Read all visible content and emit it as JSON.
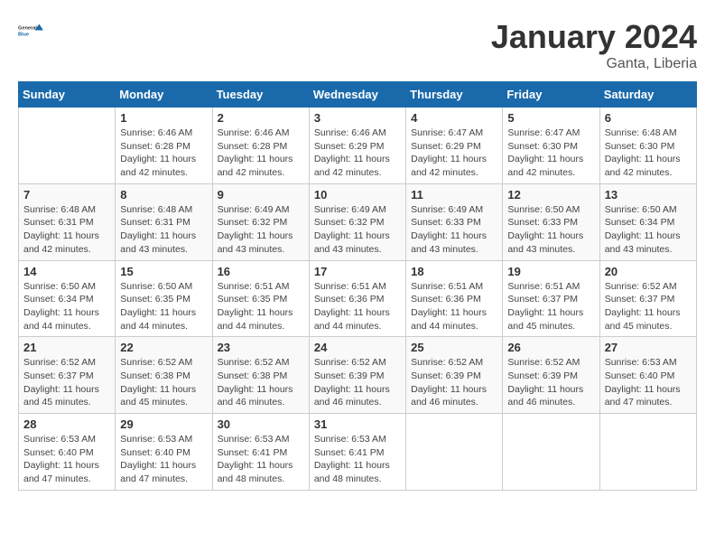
{
  "header": {
    "logo_general": "General",
    "logo_blue": "Blue",
    "month_year": "January 2024",
    "location": "Ganta, Liberia"
  },
  "weekdays": [
    "Sunday",
    "Monday",
    "Tuesday",
    "Wednesday",
    "Thursday",
    "Friday",
    "Saturday"
  ],
  "weeks": [
    [
      {
        "day": "",
        "sunrise": "",
        "sunset": "",
        "daylight": ""
      },
      {
        "day": "1",
        "sunrise": "Sunrise: 6:46 AM",
        "sunset": "Sunset: 6:28 PM",
        "daylight": "Daylight: 11 hours and 42 minutes."
      },
      {
        "day": "2",
        "sunrise": "Sunrise: 6:46 AM",
        "sunset": "Sunset: 6:28 PM",
        "daylight": "Daylight: 11 hours and 42 minutes."
      },
      {
        "day": "3",
        "sunrise": "Sunrise: 6:46 AM",
        "sunset": "Sunset: 6:29 PM",
        "daylight": "Daylight: 11 hours and 42 minutes."
      },
      {
        "day": "4",
        "sunrise": "Sunrise: 6:47 AM",
        "sunset": "Sunset: 6:29 PM",
        "daylight": "Daylight: 11 hours and 42 minutes."
      },
      {
        "day": "5",
        "sunrise": "Sunrise: 6:47 AM",
        "sunset": "Sunset: 6:30 PM",
        "daylight": "Daylight: 11 hours and 42 minutes."
      },
      {
        "day": "6",
        "sunrise": "Sunrise: 6:48 AM",
        "sunset": "Sunset: 6:30 PM",
        "daylight": "Daylight: 11 hours and 42 minutes."
      }
    ],
    [
      {
        "day": "7",
        "sunrise": "Sunrise: 6:48 AM",
        "sunset": "Sunset: 6:31 PM",
        "daylight": "Daylight: 11 hours and 42 minutes."
      },
      {
        "day": "8",
        "sunrise": "Sunrise: 6:48 AM",
        "sunset": "Sunset: 6:31 PM",
        "daylight": "Daylight: 11 hours and 43 minutes."
      },
      {
        "day": "9",
        "sunrise": "Sunrise: 6:49 AM",
        "sunset": "Sunset: 6:32 PM",
        "daylight": "Daylight: 11 hours and 43 minutes."
      },
      {
        "day": "10",
        "sunrise": "Sunrise: 6:49 AM",
        "sunset": "Sunset: 6:32 PM",
        "daylight": "Daylight: 11 hours and 43 minutes."
      },
      {
        "day": "11",
        "sunrise": "Sunrise: 6:49 AM",
        "sunset": "Sunset: 6:33 PM",
        "daylight": "Daylight: 11 hours and 43 minutes."
      },
      {
        "day": "12",
        "sunrise": "Sunrise: 6:50 AM",
        "sunset": "Sunset: 6:33 PM",
        "daylight": "Daylight: 11 hours and 43 minutes."
      },
      {
        "day": "13",
        "sunrise": "Sunrise: 6:50 AM",
        "sunset": "Sunset: 6:34 PM",
        "daylight": "Daylight: 11 hours and 43 minutes."
      }
    ],
    [
      {
        "day": "14",
        "sunrise": "Sunrise: 6:50 AM",
        "sunset": "Sunset: 6:34 PM",
        "daylight": "Daylight: 11 hours and 44 minutes."
      },
      {
        "day": "15",
        "sunrise": "Sunrise: 6:50 AM",
        "sunset": "Sunset: 6:35 PM",
        "daylight": "Daylight: 11 hours and 44 minutes."
      },
      {
        "day": "16",
        "sunrise": "Sunrise: 6:51 AM",
        "sunset": "Sunset: 6:35 PM",
        "daylight": "Daylight: 11 hours and 44 minutes."
      },
      {
        "day": "17",
        "sunrise": "Sunrise: 6:51 AM",
        "sunset": "Sunset: 6:36 PM",
        "daylight": "Daylight: 11 hours and 44 minutes."
      },
      {
        "day": "18",
        "sunrise": "Sunrise: 6:51 AM",
        "sunset": "Sunset: 6:36 PM",
        "daylight": "Daylight: 11 hours and 44 minutes."
      },
      {
        "day": "19",
        "sunrise": "Sunrise: 6:51 AM",
        "sunset": "Sunset: 6:37 PM",
        "daylight": "Daylight: 11 hours and 45 minutes."
      },
      {
        "day": "20",
        "sunrise": "Sunrise: 6:52 AM",
        "sunset": "Sunset: 6:37 PM",
        "daylight": "Daylight: 11 hours and 45 minutes."
      }
    ],
    [
      {
        "day": "21",
        "sunrise": "Sunrise: 6:52 AM",
        "sunset": "Sunset: 6:37 PM",
        "daylight": "Daylight: 11 hours and 45 minutes."
      },
      {
        "day": "22",
        "sunrise": "Sunrise: 6:52 AM",
        "sunset": "Sunset: 6:38 PM",
        "daylight": "Daylight: 11 hours and 45 minutes."
      },
      {
        "day": "23",
        "sunrise": "Sunrise: 6:52 AM",
        "sunset": "Sunset: 6:38 PM",
        "daylight": "Daylight: 11 hours and 46 minutes."
      },
      {
        "day": "24",
        "sunrise": "Sunrise: 6:52 AM",
        "sunset": "Sunset: 6:39 PM",
        "daylight": "Daylight: 11 hours and 46 minutes."
      },
      {
        "day": "25",
        "sunrise": "Sunrise: 6:52 AM",
        "sunset": "Sunset: 6:39 PM",
        "daylight": "Daylight: 11 hours and 46 minutes."
      },
      {
        "day": "26",
        "sunrise": "Sunrise: 6:52 AM",
        "sunset": "Sunset: 6:39 PM",
        "daylight": "Daylight: 11 hours and 46 minutes."
      },
      {
        "day": "27",
        "sunrise": "Sunrise: 6:53 AM",
        "sunset": "Sunset: 6:40 PM",
        "daylight": "Daylight: 11 hours and 47 minutes."
      }
    ],
    [
      {
        "day": "28",
        "sunrise": "Sunrise: 6:53 AM",
        "sunset": "Sunset: 6:40 PM",
        "daylight": "Daylight: 11 hours and 47 minutes."
      },
      {
        "day": "29",
        "sunrise": "Sunrise: 6:53 AM",
        "sunset": "Sunset: 6:40 PM",
        "daylight": "Daylight: 11 hours and 47 minutes."
      },
      {
        "day": "30",
        "sunrise": "Sunrise: 6:53 AM",
        "sunset": "Sunset: 6:41 PM",
        "daylight": "Daylight: 11 hours and 48 minutes."
      },
      {
        "day": "31",
        "sunrise": "Sunrise: 6:53 AM",
        "sunset": "Sunset: 6:41 PM",
        "daylight": "Daylight: 11 hours and 48 minutes."
      },
      {
        "day": "",
        "sunrise": "",
        "sunset": "",
        "daylight": ""
      },
      {
        "day": "",
        "sunrise": "",
        "sunset": "",
        "daylight": ""
      },
      {
        "day": "",
        "sunrise": "",
        "sunset": "",
        "daylight": ""
      }
    ]
  ]
}
